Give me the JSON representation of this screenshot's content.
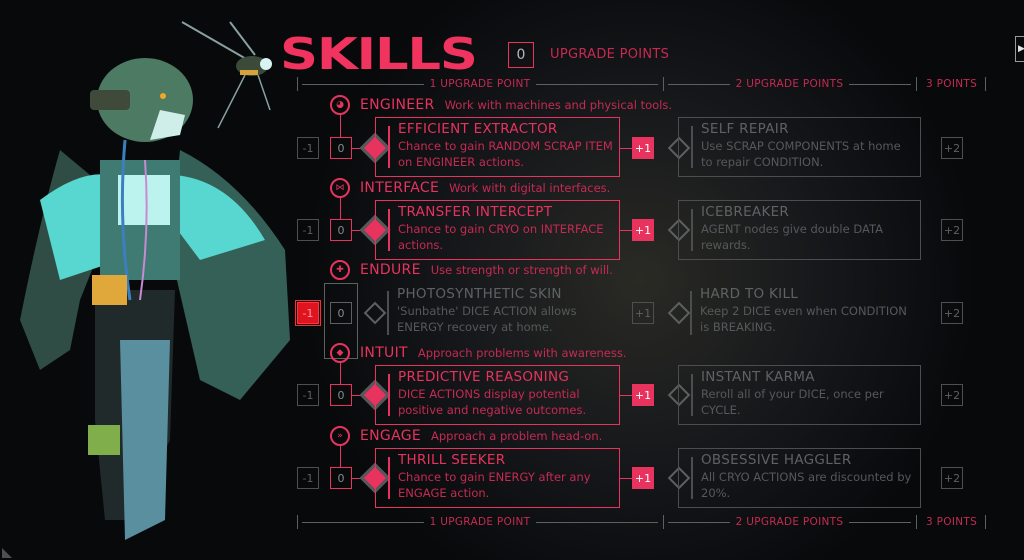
{
  "header": {
    "title": "SKILLS",
    "upgrade_points_value": "0",
    "upgrade_points_label": "UPGRADE POINTS"
  },
  "tiers": {
    "tier1": "1 UPGRADE POINT",
    "tier2": "2 UPGRADE POINTS",
    "tier3": "3 POINTS"
  },
  "categories": [
    {
      "name": "ENGINEER",
      "description": "Work with machines and physical tools.",
      "icon": "gear-wrench-icon",
      "minus": "-1",
      "level": "0",
      "plus1": "+1",
      "plus2": "+2",
      "skill1": {
        "name": "EFFICIENT EXTRACTOR",
        "description": "Chance to gain RANDOM SCRAP ITEM on ENGINEER actions.",
        "unlocked": true
      },
      "skill2": {
        "name": "SELF REPAIR",
        "description": "Use SCRAP COMPONENTS at home to repair CONDITION.",
        "unlocked": false
      }
    },
    {
      "name": "INTERFACE",
      "description": "Work with digital interfaces.",
      "icon": "bowtie-icon",
      "minus": "-1",
      "level": "0",
      "plus1": "+1",
      "plus2": "+2",
      "skill1": {
        "name": "TRANSFER INTERCEPT",
        "description": "Chance to gain CRYO on INTERFACE actions.",
        "unlocked": true
      },
      "skill2": {
        "name": "ICEBREAKER",
        "description": "AGENT nodes give double DATA rewards.",
        "unlocked": false
      }
    },
    {
      "name": "ENDURE",
      "description": "Use strength or strength of will.",
      "icon": "cross-icon",
      "minus": "-1",
      "level": "0",
      "plus1": "+1",
      "plus2": "+2",
      "skill1": {
        "name": "PHOTOSYNTHETIC SKIN",
        "description": "'Sunbathe' DICE ACTION allows ENERGY recovery at home.",
        "unlocked": false
      },
      "skill2": {
        "name": "HARD TO KILL",
        "description": "Keep 2 DICE even when CONDITION is BREAKING.",
        "unlocked": false
      }
    },
    {
      "name": "INTUIT",
      "description": "Approach problems with awareness.",
      "icon": "eye-diamond-icon",
      "minus": "-1",
      "level": "0",
      "plus1": "+1",
      "plus2": "+2",
      "skill1": {
        "name": "PREDICTIVE REASONING",
        "description": "DICE ACTIONS display potential positive and negative outcomes.",
        "unlocked": true
      },
      "skill2": {
        "name": "INSTANT KARMA",
        "description": "Reroll all of your DICE, once per CYCLE.",
        "unlocked": false
      }
    },
    {
      "name": "ENGAGE",
      "description": "Approach a problem head-on.",
      "icon": "fast-forward-icon",
      "minus": "-1",
      "level": "0",
      "plus1": "+1",
      "plus2": "+2",
      "skill1": {
        "name": "THRILL SEEKER",
        "description": "Chance to gain ENERGY after any ENGAGE action.",
        "unlocked": true
      },
      "skill2": {
        "name": "OBSESSIVE HAGGLER",
        "description": "All CRYO ACTIONS are discounted by 20%.",
        "unlocked": false
      }
    }
  ],
  "nav": {
    "next_glyph": "▶"
  },
  "colors": {
    "accent": "#e8335e",
    "inactive": "#5c6060",
    "background": "#07090b"
  }
}
